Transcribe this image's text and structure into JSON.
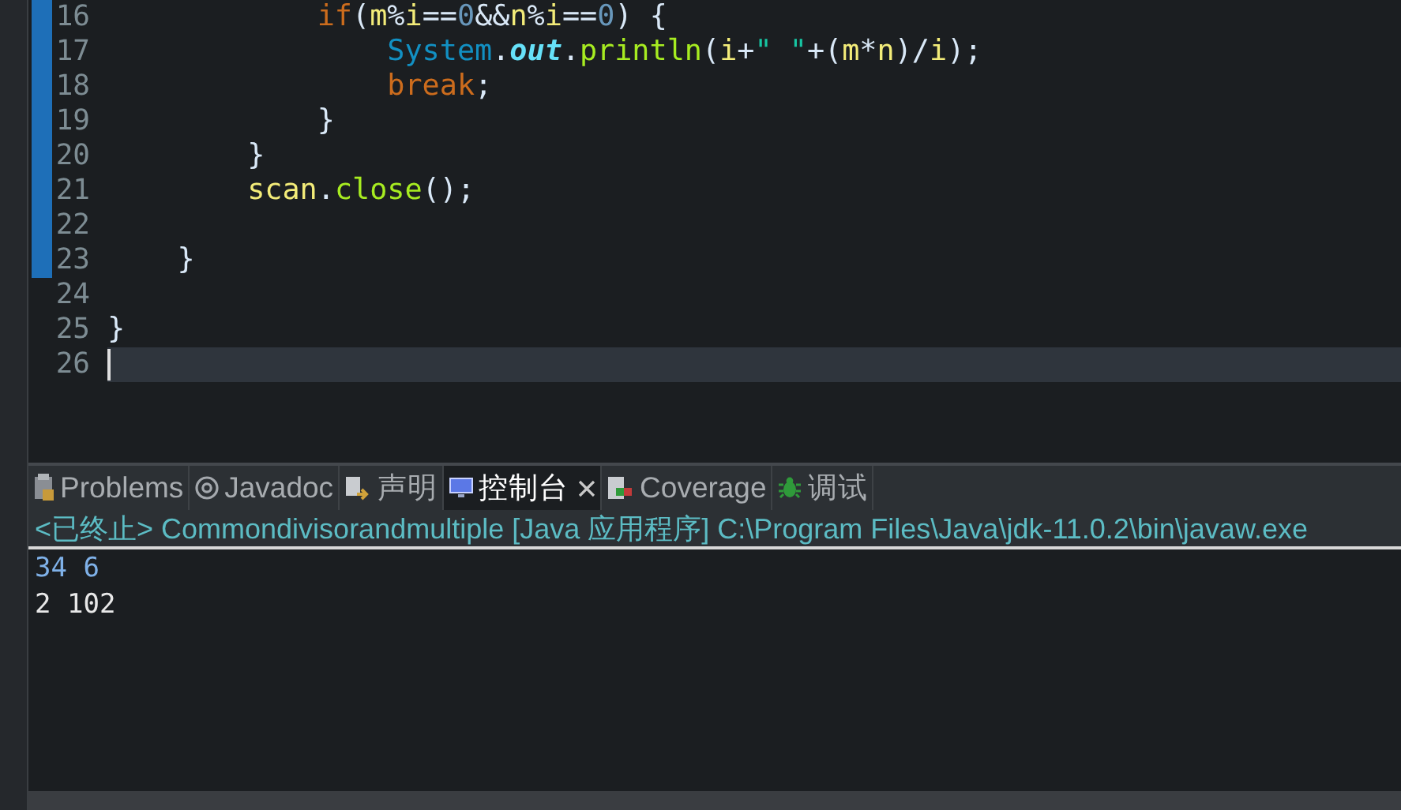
{
  "editor": {
    "lines": [
      {
        "number": "16",
        "changed": true,
        "current": false,
        "tokens": [
          {
            "text": "            if",
            "kind": "keyword"
          },
          {
            "text": "(",
            "kind": "plain"
          },
          {
            "text": "m",
            "kind": "variable"
          },
          {
            "text": "%",
            "kind": "plain"
          },
          {
            "text": "i",
            "kind": "variable"
          },
          {
            "text": "==",
            "kind": "plain"
          },
          {
            "text": "0",
            "kind": "number"
          },
          {
            "text": "&&",
            "kind": "plain"
          },
          {
            "text": "n",
            "kind": "variable"
          },
          {
            "text": "%",
            "kind": "plain"
          },
          {
            "text": "i",
            "kind": "variable"
          },
          {
            "text": "==",
            "kind": "plain"
          },
          {
            "text": "0",
            "kind": "number"
          },
          {
            "text": ") {",
            "kind": "plain"
          }
        ]
      },
      {
        "number": "17",
        "changed": true,
        "current": false,
        "tokens": [
          {
            "text": "                System",
            "kind": "class"
          },
          {
            "text": ".",
            "kind": "plain"
          },
          {
            "text": "out",
            "kind": "field"
          },
          {
            "text": ".",
            "kind": "plain"
          },
          {
            "text": "println",
            "kind": "method"
          },
          {
            "text": "(",
            "kind": "plain"
          },
          {
            "text": "i",
            "kind": "variable"
          },
          {
            "text": "+",
            "kind": "plain"
          },
          {
            "text": "\" \"",
            "kind": "string"
          },
          {
            "text": "+(",
            "kind": "plain"
          },
          {
            "text": "m",
            "kind": "variable"
          },
          {
            "text": "*",
            "kind": "plain"
          },
          {
            "text": "n",
            "kind": "variable"
          },
          {
            "text": ")/",
            "kind": "plain"
          },
          {
            "text": "i",
            "kind": "variable"
          },
          {
            "text": ");",
            "kind": "plain"
          }
        ]
      },
      {
        "number": "18",
        "changed": true,
        "current": false,
        "tokens": [
          {
            "text": "                break",
            "kind": "keyword"
          },
          {
            "text": ";",
            "kind": "plain"
          }
        ]
      },
      {
        "number": "19",
        "changed": true,
        "current": false,
        "tokens": [
          {
            "text": "            }",
            "kind": "plain"
          }
        ]
      },
      {
        "number": "20",
        "changed": true,
        "current": false,
        "tokens": [
          {
            "text": "        }",
            "kind": "plain"
          }
        ]
      },
      {
        "number": "21",
        "changed": true,
        "current": false,
        "tokens": [
          {
            "text": "        scan",
            "kind": "variable"
          },
          {
            "text": ".",
            "kind": "plain"
          },
          {
            "text": "close",
            "kind": "method"
          },
          {
            "text": "();",
            "kind": "plain"
          }
        ]
      },
      {
        "number": "22",
        "changed": true,
        "current": false
      },
      {
        "number": "23",
        "changed": true,
        "current": false,
        "tokens": [
          {
            "text": "    }",
            "kind": "plain"
          }
        ]
      },
      {
        "number": "24",
        "changed": false,
        "current": false
      },
      {
        "number": "25",
        "changed": false,
        "current": false,
        "tokens": [
          {
            "text": "}",
            "kind": "plain"
          }
        ]
      },
      {
        "number": "26",
        "changed": false,
        "current": true
      }
    ]
  },
  "console": {
    "tabs": [
      {
        "label": "Problems",
        "selected": false
      },
      {
        "label": "Javadoc",
        "selected": false
      },
      {
        "label": "声明",
        "selected": false
      },
      {
        "label": "控制台",
        "selected": true
      },
      {
        "label": "Coverage",
        "selected": false
      },
      {
        "label": "调试",
        "selected": false
      }
    ],
    "header": "<已终止> Commondivisorandmultiple [Java 应用程序] C:\\Program Files\\Java\\jdk-11.0.2\\bin\\javaw.exe",
    "output": [
      {
        "text": "34 6",
        "kind": "input"
      },
      {
        "text": "2 102",
        "kind": "output"
      }
    ]
  }
}
